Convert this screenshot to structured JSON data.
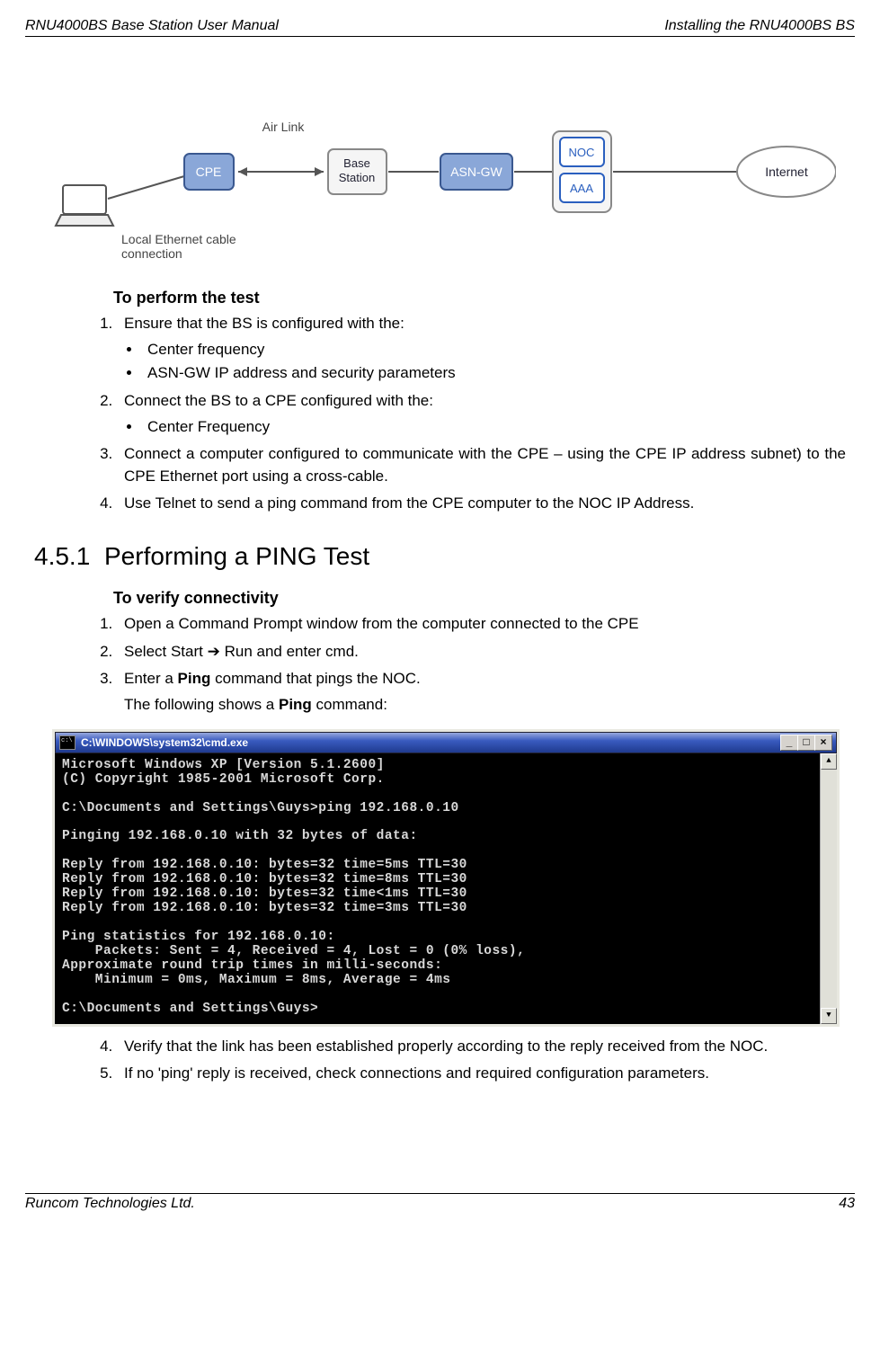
{
  "header": {
    "left": "RNU4000BS Base Station User Manual",
    "right": "Installing the RNU4000BS BS"
  },
  "diagram": {
    "air_link": "Air Link",
    "cpe": "CPE",
    "bs": "Base\nStation",
    "asn": "ASN-GW",
    "noc": "NOC",
    "aaa": "AAA",
    "internet": "Internet",
    "local_eth": "Local Ethernet cable\nconnection"
  },
  "sec1": {
    "h": "To perform the test",
    "i1": "Ensure that the BS is configured with the:",
    "i1a": "Center frequency",
    "i1b": "ASN-GW IP address and security parameters",
    "i2": "Connect the BS to a CPE configured with the:",
    "i2a": "Center Frequency",
    "i3": " Connect a computer configured to communicate with the CPE – using the CPE IP address subnet) to the CPE Ethernet port using a cross-cable.",
    "i4": "Use Telnet to send a ping command from the CPE computer to the NOC IP Address."
  },
  "section_num": "4.5.1",
  "section_title": "Performing a PING Test",
  "sec2": {
    "h": "To verify connectivity",
    "i1": "Open a Command Prompt window from the computer connected to the CPE",
    "i2_a": "Select Start ",
    "i2_arrow": "➔",
    "i2_b": " Run and enter cmd.",
    "i3_a": "Enter a ",
    "i3_kw": "Ping",
    "i3_b": " command that pings the NOC.",
    "i3_c_a": "The following shows a ",
    "i3_c_kw": "Ping",
    "i3_c_b": " command:",
    "i4": "Verify that the link has been established properly according to the reply received from the NOC.",
    "i5": "If no 'ping' reply is received, check connections and required configuration parameters."
  },
  "cmd": {
    "title": "C:\\WINDOWS\\system32\\cmd.exe",
    "min": "_",
    "max": "□",
    "close": "×",
    "body": "Microsoft Windows XP [Version 5.1.2600]\n(C) Copyright 1985-2001 Microsoft Corp.\n\nC:\\Documents and Settings\\Guys>ping 192.168.0.10\n\nPinging 192.168.0.10 with 32 bytes of data:\n\nReply from 192.168.0.10: bytes=32 time=5ms TTL=30\nReply from 192.168.0.10: bytes=32 time=8ms TTL=30\nReply from 192.168.0.10: bytes=32 time<1ms TTL=30\nReply from 192.168.0.10: bytes=32 time=3ms TTL=30\n\nPing statistics for 192.168.0.10:\n    Packets: Sent = 4, Received = 4, Lost = 0 (0% loss),\nApproximate round trip times in milli-seconds:\n    Minimum = 0ms, Maximum = 8ms, Average = 4ms\n\nC:\\Documents and Settings\\Guys>"
  },
  "footer": {
    "left": "Runcom Technologies Ltd.",
    "right": "43"
  }
}
